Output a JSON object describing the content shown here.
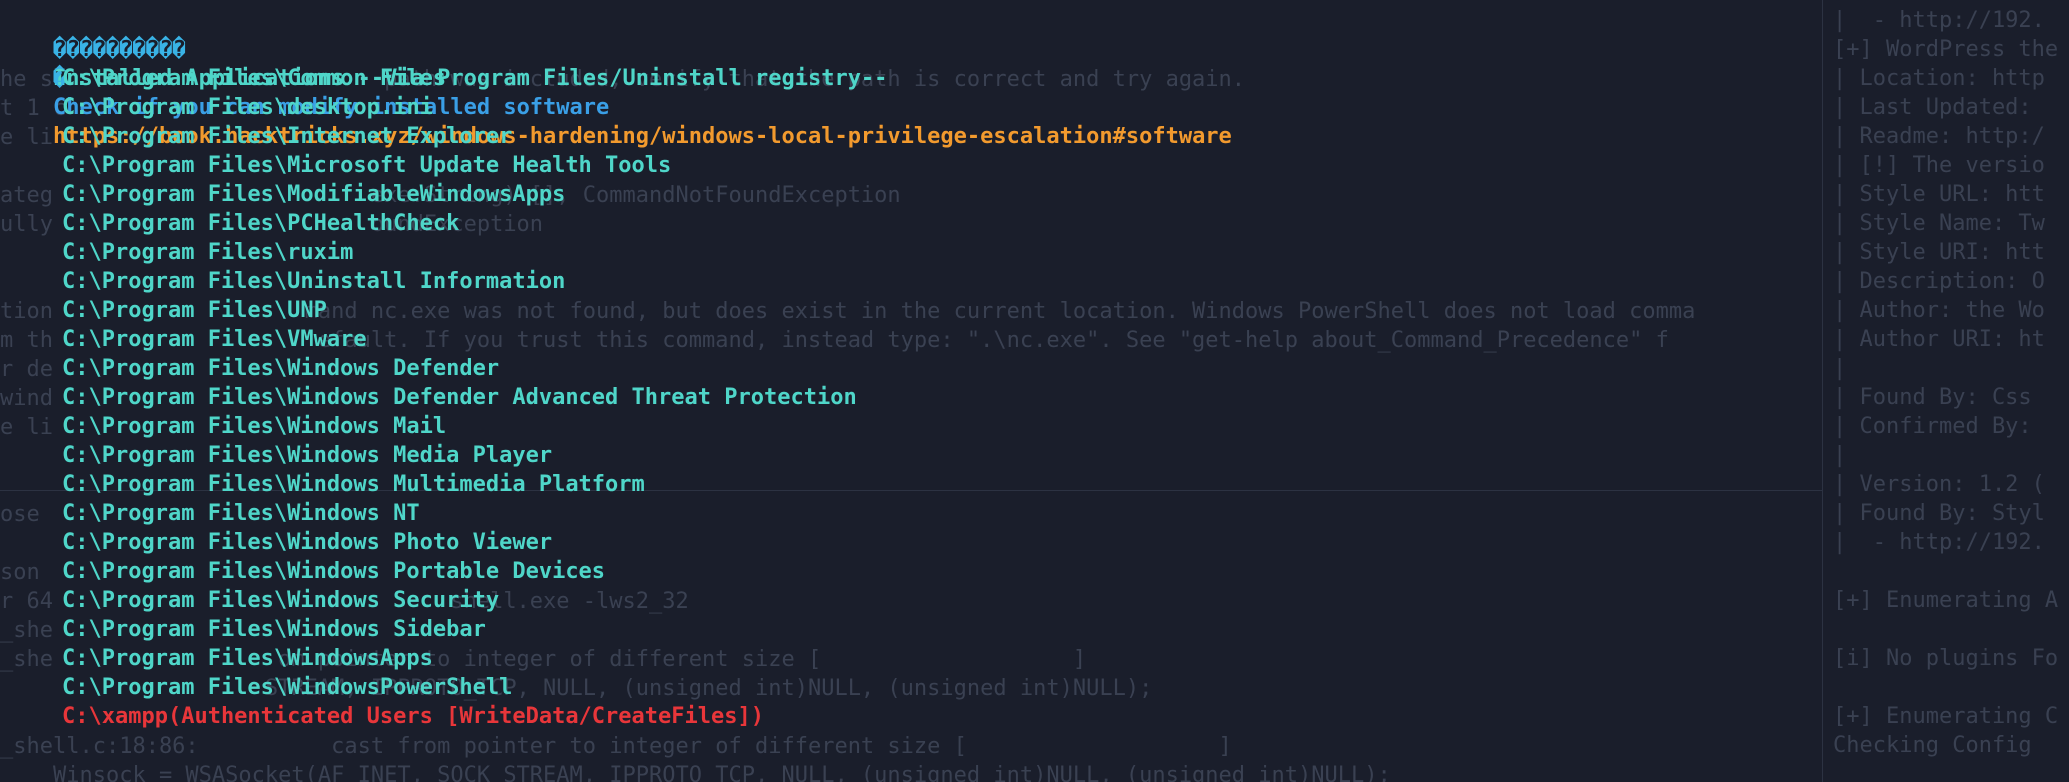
{
  "terminal": {
    "header": {
      "marker": "����������",
      "title": "Installed Applications --Via Program Files/Uninstall registry--"
    },
    "check": {
      "marker": "�",
      "text": "Check if you can modify installed software",
      "link": "https://book.hacktricks.xyz/windows-hardening/windows-local-privilege-escalation#software"
    },
    "entries": [
      "C:\\Program Files\\Common Files",
      "C:\\Program Files\\desktop.ini",
      "C:\\Program Files\\Internet Explorer",
      "C:\\Program Files\\Microsoft Update Health Tools",
      "C:\\Program Files\\ModifiableWindowsApps",
      "C:\\Program Files\\PCHealthCheck",
      "C:\\Program Files\\ruxim",
      "C:\\Program Files\\Uninstall Information",
      "C:\\Program Files\\UNP",
      "C:\\Program Files\\VMware",
      "C:\\Program Files\\Windows Defender",
      "C:\\Program Files\\Windows Defender Advanced Threat Protection",
      "C:\\Program Files\\Windows Mail",
      "C:\\Program Files\\Windows Media Player",
      "C:\\Program Files\\Windows Multimedia Platform",
      "C:\\Program Files\\Windows NT",
      "C:\\Program Files\\Windows Photo Viewer",
      "C:\\Program Files\\Windows Portable Devices",
      "C:\\Program Files\\Windows Security",
      "C:\\Program Files\\Windows Sidebar",
      "C:\\Program Files\\WindowsApps",
      "C:\\Program Files\\WindowsPowerShell"
    ],
    "warning_entry": "C:\\xampp(Authenticated Users [WriteData/CreateFiles])"
  },
  "background": {
    "left_lines": [
      "he s                         path was included, verify that the path is correct and try again.",
      "t 1 c",
      "e li",
      "",
      "ateg                        exe:String) [], CommandNotFoundException",
      "ully                        oundException",
      "",
      "",
      "tion                   mand nc.exe was not found, but does exist in the current location. Windows PowerShell does not load comma",
      "m th                    efault. If you trust this command, instead type: \".\\nc.exe\". See \"get-help about_Command_Precedence\" f",
      "r de",
      "wind",
      "e li",
      "",
      "",
      "ose",
      "",
      "son",
      "r 64                              shell.exe -lws2_32",
      "_she",
      "_she                 om pointer to integer of different size [                   ]",
      "                    STREAM, IPPROTO_TCP, NULL, (unsigned int)NULL, (unsigned int)NULL);",
      "",
      "_shell.c:18:86:          cast from pointer to integer of different size [                   ]",
      "    Winsock = WSASocket(AF_INET, SOCK_STREAM, IPPROTO_TCP, NULL, (unsigned int)NULL, (unsigned int)NULL);"
    ],
    "right_lines": [
      "|  - http://192.",
      "[+] WordPress the",
      "| Location: http",
      "| Last Updated:",
      "| Readme: http:/",
      "| [!] The versio",
      "| Style URL: htt",
      "| Style Name: Tw",
      "| Style URI: htt",
      "| Description: O",
      "| Author: the Wo",
      "| Author URI: ht",
      "|",
      "| Found By: Css",
      "| Confirmed By:",
      "|",
      "| Version: 1.2 (",
      "| Found By: Styl",
      "|  - http://192.",
      "",
      "[+] Enumerating A",
      "",
      "[i] No plugins Fo",
      "",
      "[+] Enumerating C",
      "Checking Config"
    ]
  },
  "colors": {
    "background": "#1a1e2b",
    "cyan_text": "#4fd6c9",
    "blue_text": "#3a9fe6",
    "link_orange": "#f29a2e",
    "warning_red": "#e8363a",
    "dim_text": "#3a4152"
  }
}
